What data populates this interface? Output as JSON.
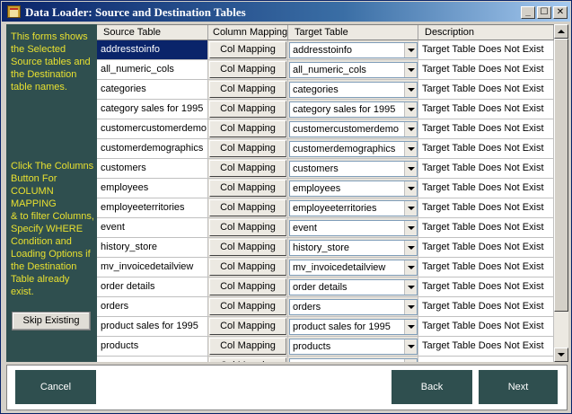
{
  "window": {
    "title": "Data Loader: Source and Destination Tables",
    "controls": {
      "minimize": "_",
      "maximize": "☐",
      "close": "✕"
    }
  },
  "left_panel": {
    "intro_lines": [
      "This forms shows",
      "the Selected",
      "Source tables and",
      "the Destination",
      "table names."
    ],
    "help_lines": [
      "Click The Columns",
      "Button For",
      "COLUMN MAPPING",
      "& to filter Columns,",
      "Specify WHERE",
      "Condition and",
      "Loading Options if",
      "the Destination",
      "Table already",
      "exist."
    ],
    "skip_button": "Skip Existing"
  },
  "grid": {
    "headers": [
      "Source Table",
      "Column Mapping",
      "Target Table",
      "Description"
    ],
    "rows": [
      {
        "source": "addresstoinfo",
        "map": "Col Mapping",
        "target": "addresstoinfo",
        "desc": "Target Table Does Not Exist"
      },
      {
        "source": "all_numeric_cols",
        "map": "Col Mapping",
        "target": "all_numeric_cols",
        "desc": "Target Table Does Not Exist"
      },
      {
        "source": "categories",
        "map": "Col Mapping",
        "target": "categories",
        "desc": "Target Table Does Not Exist"
      },
      {
        "source": "category sales for 1995",
        "map": "Col Mapping",
        "target": "category sales for 1995",
        "desc": "Target Table Does Not Exist"
      },
      {
        "source": "customercustomerdemo",
        "map": "Col Mapping",
        "target": "customercustomerdemo",
        "desc": "Target Table Does Not Exist"
      },
      {
        "source": "customerdemographics",
        "map": "Col Mapping",
        "target": "customerdemographics",
        "desc": "Target Table Does Not Exist"
      },
      {
        "source": "customers",
        "map": "Col Mapping",
        "target": "customers",
        "desc": "Target Table Does Not Exist"
      },
      {
        "source": "employees",
        "map": "Col Mapping",
        "target": "employees",
        "desc": "Target Table Does Not Exist"
      },
      {
        "source": "employeeterritories",
        "map": "Col Mapping",
        "target": "employeeterritories",
        "desc": "Target Table Does Not Exist"
      },
      {
        "source": "event",
        "map": "Col Mapping",
        "target": "event",
        "desc": "Target Table Does Not Exist"
      },
      {
        "source": "history_store",
        "map": "Col Mapping",
        "target": "history_store",
        "desc": "Target Table Does Not Exist"
      },
      {
        "source": "mv_invoicedetailview",
        "map": "Col Mapping",
        "target": "mv_invoicedetailview",
        "desc": "Target Table Does Not Exist"
      },
      {
        "source": "order details",
        "map": "Col Mapping",
        "target": "order details",
        "desc": "Target Table Does Not Exist"
      },
      {
        "source": "orders",
        "map": "Col Mapping",
        "target": "orders",
        "desc": "Target Table Does Not Exist"
      },
      {
        "source": "product sales for 1995",
        "map": "Col Mapping",
        "target": "product sales for 1995",
        "desc": "Target Table Does Not Exist"
      },
      {
        "source": "products",
        "map": "Col Mapping",
        "target": "products",
        "desc": "Target Table Does Not Exist"
      },
      {
        "source": "",
        "map": "Col Mapping",
        "target": "",
        "desc": ""
      }
    ],
    "selected_row": 0
  },
  "footer": {
    "cancel": "Cancel",
    "back": "Back",
    "next": "Next"
  },
  "colors": {
    "panel_bg": "#2f4f4f",
    "panel_text": "#e8e030",
    "selection": "#0a246a"
  }
}
